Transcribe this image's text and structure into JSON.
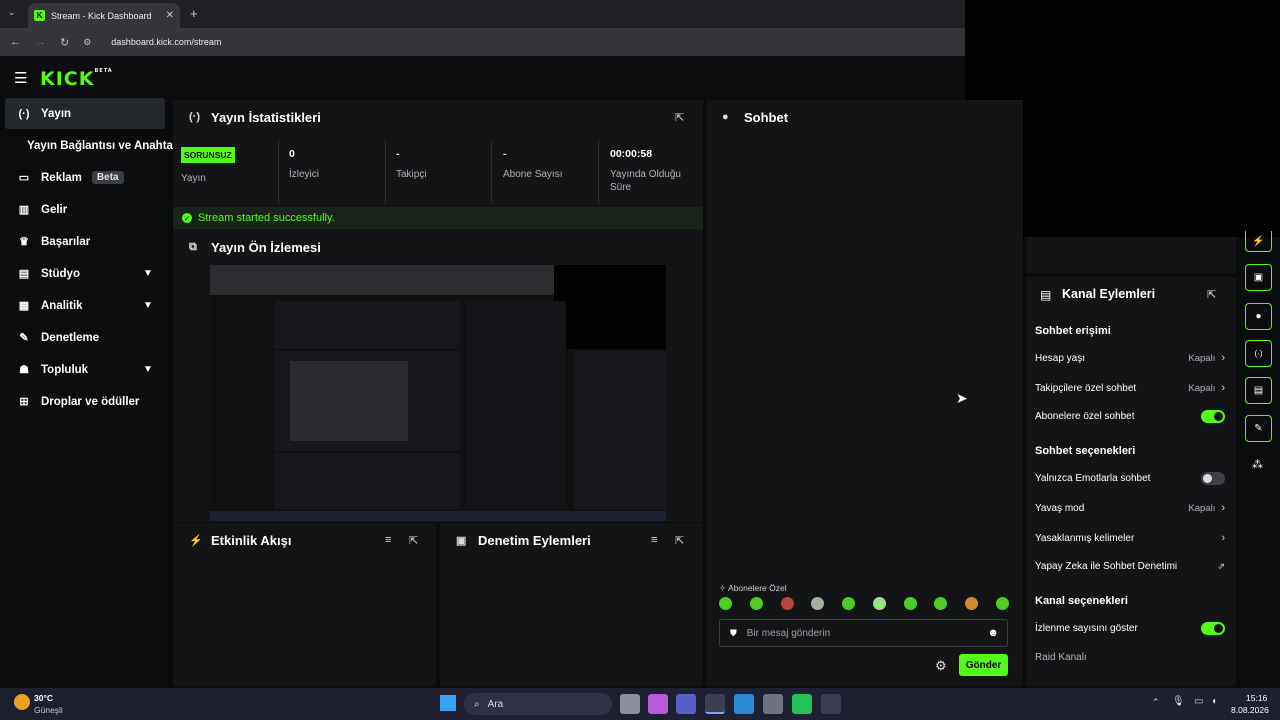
{
  "browser": {
    "tab_title": "Stream - Kick Dashboard",
    "new_tab": "+",
    "url": "dashboard.kick.com/stream"
  },
  "logo": {
    "text": "KICK",
    "tag": "BETA"
  },
  "sidebar": {
    "items": [
      {
        "label": "Yayın",
        "icon": "broadcast-icon"
      },
      {
        "label": "Yayın Bağlantısı ve Anahtarı"
      },
      {
        "label": "Reklam",
        "badge": "Beta",
        "icon": "ad-icon"
      },
      {
        "label": "Gelir",
        "icon": "chart-icon"
      },
      {
        "label": "Başarılar",
        "icon": "trophy-icon"
      },
      {
        "label": "Stüdyo",
        "icon": "studio-icon"
      },
      {
        "label": "Analitik",
        "icon": "analytics-icon"
      },
      {
        "label": "Denetleme",
        "icon": "wrench-icon"
      },
      {
        "label": "Topluluk",
        "icon": "community-icon"
      },
      {
        "label": "Droplar ve ödüller",
        "icon": "drops-icon"
      }
    ]
  },
  "stats_panel": {
    "title": "Yayın İstatistikleri",
    "status_badge": "SORUNSUZ",
    "status_label": "Yayın",
    "stats": [
      {
        "value": "0",
        "label": "İzleyici"
      },
      {
        "value": "-",
        "label": "Takipçi"
      },
      {
        "value": "-",
        "label": "Abone Sayısı"
      },
      {
        "value": "00:00:58",
        "label1": "Yayında Olduğu",
        "label2": "Süre"
      }
    ],
    "success_message": "Stream started successfully."
  },
  "preview_panel": {
    "title": "Yayın Ön İzlemesi"
  },
  "activity_panel": {
    "title": "Etkinlik Akışı"
  },
  "moderation_panel": {
    "title": "Denetim Eylemleri"
  },
  "chat": {
    "title": "Sohbet",
    "subscriber_label": "Abonelere Özel",
    "input_placeholder": "Bir mesaj gönderin",
    "send_label": "Gönder"
  },
  "channel_actions": {
    "title": "Kanal Eylemleri",
    "sections": {
      "chat_access": "Sohbet erişimi",
      "chat_options": "Sohbet seçenekleri",
      "channel_options": "Kanal seçenekleri"
    },
    "rows": {
      "account_age": {
        "label": "Hesap yaşı",
        "value": "Kapalı"
      },
      "followers_only": {
        "label": "Takipçilere özel sohbet",
        "value": "Kapalı"
      },
      "subscribers_only": {
        "label": "Abonelere özel sohbet",
        "on": true
      },
      "emotes_only": {
        "label": "Yalnızca Emotlarla sohbet",
        "on": false
      },
      "slow_mode": {
        "label": "Yavaş mod",
        "value": "Kapalı"
      },
      "banned_words": {
        "label": "Yasaklanmış kelimeler"
      },
      "ai_moderation": {
        "label": "Yapay Zeka ile Sohbet Denetimi"
      },
      "show_viewers": {
        "label": "İzlenme sayısını göster",
        "on": true
      },
      "raid_channel": {
        "label": "Raid Kanalı"
      }
    }
  },
  "taskbar": {
    "weather_temp": "30°C",
    "weather_desc": "Güneşli",
    "search_label": "Ara",
    "time": "15:16",
    "date": "8.08.2026"
  },
  "colors": {
    "accent": "#53fc18",
    "panel": "#131416",
    "background": "#0b0c0d"
  }
}
